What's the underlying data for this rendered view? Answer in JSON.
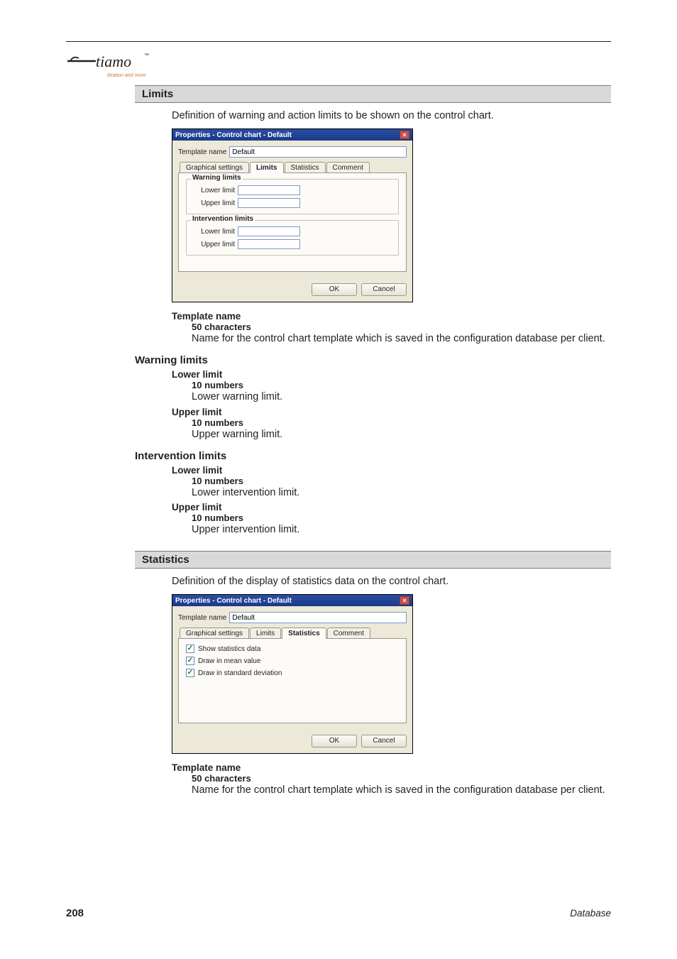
{
  "logo_text": "tiamo",
  "logo_sub": "titration and more",
  "limits": {
    "head": "Limits",
    "intro": "Definition of warning and action limits to be shown on the control chart.",
    "dialog": {
      "title": "Properties - Control chart - Default",
      "template_label": "Template name",
      "template_value": "Default",
      "tabs": {
        "graphical": "Graphical settings",
        "limits": "Limits",
        "statistics": "Statistics",
        "comment": "Comment"
      },
      "group_warning": "Warning limits",
      "group_intervention": "Intervention limits",
      "lower_label": "Lower limit",
      "upper_label": "Upper limit",
      "ok": "OK",
      "cancel": "Cancel"
    },
    "template_block": {
      "term": "Template name",
      "sub": "50 characters",
      "body": "Name for the control chart template which is saved in the configuration database per client."
    },
    "warning_head": "Warning limits",
    "warning_lower": {
      "term": "Lower limit",
      "sub": "10 numbers",
      "body": "Lower warning limit."
    },
    "warning_upper": {
      "term": "Upper limit",
      "sub": "10 numbers",
      "body": "Upper warning limit."
    },
    "intervention_head": "Intervention limits",
    "intervention_lower": {
      "term": "Lower limit",
      "sub": "10 numbers",
      "body": "Lower intervention limit."
    },
    "intervention_upper": {
      "term": "Upper limit",
      "sub": "10 numbers",
      "body": "Upper intervention limit."
    }
  },
  "stats": {
    "head": "Statistics",
    "intro": "Definition of the display of statistics data on the control chart.",
    "dialog": {
      "title": "Properties - Control chart - Default",
      "template_label": "Template name",
      "template_value": "Default",
      "tabs": {
        "graphical": "Graphical settings",
        "limits": "Limits",
        "statistics": "Statistics",
        "comment": "Comment"
      },
      "cb_show": "Show statistics data",
      "cb_mean": "Draw in mean value",
      "cb_sd": "Draw in standard deviation",
      "ok": "OK",
      "cancel": "Cancel"
    },
    "template_block": {
      "term": "Template name",
      "sub": "50 characters",
      "body": "Name for the control chart template which is saved in the configuration database per client."
    }
  },
  "footer": {
    "page": "208",
    "section": "Database"
  }
}
